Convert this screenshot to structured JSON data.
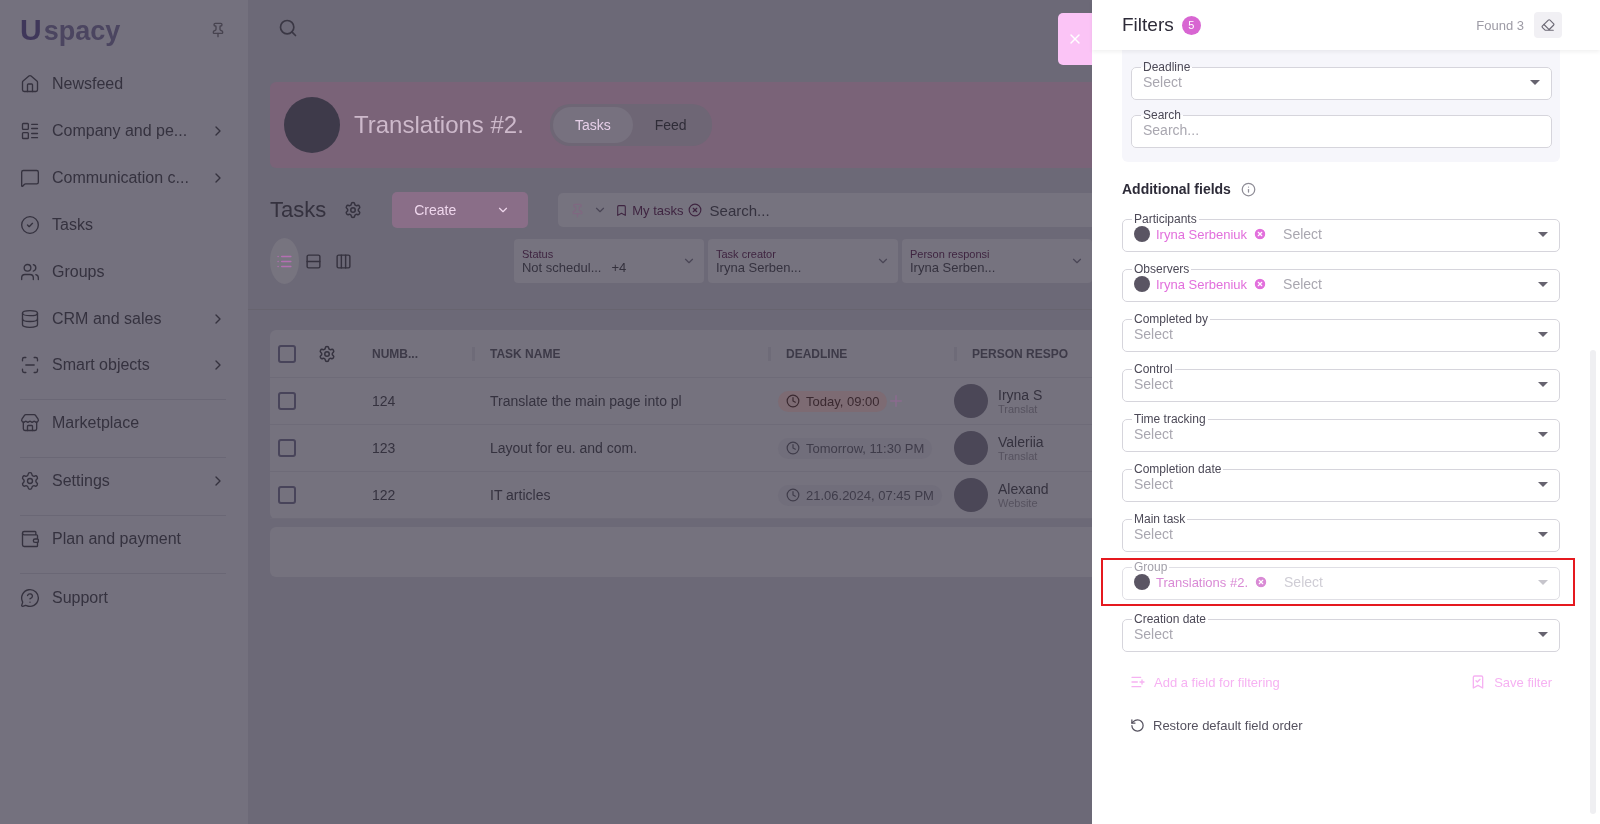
{
  "sidebar": {
    "logo": {
      "mark": "U",
      "text": "spacy"
    },
    "items": [
      {
        "label": "Newsfeed",
        "submenu": false,
        "divider_after": false
      },
      {
        "label": "Company and pe...",
        "submenu": true,
        "divider_after": false
      },
      {
        "label": "Communication c...",
        "submenu": true,
        "divider_after": false
      },
      {
        "label": "Tasks",
        "submenu": false,
        "divider_after": false
      },
      {
        "label": "Groups",
        "submenu": false,
        "divider_after": false
      },
      {
        "label": "CRM and sales",
        "submenu": true,
        "divider_after": false
      },
      {
        "label": "Smart objects",
        "submenu": true,
        "divider_after": true
      },
      {
        "label": "Marketplace",
        "submenu": false,
        "divider_after": true
      },
      {
        "label": "Settings",
        "submenu": true,
        "divider_after": true
      },
      {
        "label": "Plan and payment",
        "submenu": false,
        "divider_after": true
      },
      {
        "label": "Support",
        "submenu": false,
        "divider_after": false
      }
    ]
  },
  "group_banner": {
    "title": "Translations #2.",
    "tabs": [
      {
        "label": "Tasks",
        "selected": true
      },
      {
        "label": "Feed",
        "selected": false
      }
    ]
  },
  "toolbar": {
    "title": "Tasks",
    "create_button": "Create",
    "search_chip": "My tasks",
    "search_placeholder": "Search..."
  },
  "views": [
    {
      "selected": true
    },
    {
      "selected": false
    },
    {
      "selected": false
    }
  ],
  "quick_filters": [
    {
      "label": "Status",
      "value": "Not schedul...",
      "extra": "+4"
    },
    {
      "label": "Task creator",
      "value": "Iryna Serben..."
    },
    {
      "label": "Person responsi",
      "value": "Iryna Serben..."
    }
  ],
  "table": {
    "select_all_checked": false,
    "columns": [
      "NUMB...",
      "TASK NAME",
      "DEADLINE",
      "PERSON RESPO"
    ],
    "rows": [
      {
        "checked": false,
        "number": "124",
        "name": "Translate the main page into pl",
        "deadline": "Today, 09:00",
        "overdue": true,
        "person": "Iryna S",
        "role": "Translat"
      },
      {
        "checked": false,
        "number": "123",
        "name": "Layout for eu. and com.",
        "deadline": "Tomorrow, 11:30 PM",
        "overdue": false,
        "person": "Valeriia",
        "role": "Translat"
      },
      {
        "checked": false,
        "number": "122",
        "name": "IT articles",
        "deadline": "21.06.2024, 07:45 PM",
        "overdue": false,
        "person": "Alexand",
        "role": "Website"
      }
    ]
  },
  "drawer": {
    "title": "Filters",
    "count": "5",
    "found": "Found 3",
    "top_fields": [
      {
        "label": "Deadline",
        "kind": "select",
        "placeholder": "Select"
      },
      {
        "label": "Search",
        "kind": "text",
        "placeholder": "Search..."
      }
    ],
    "section_title": "Additional fields",
    "fields": [
      {
        "label": "Participants",
        "chip": "Iryna Serbeniuk",
        "placeholder": "Select",
        "disabled": false,
        "highlighted": false
      },
      {
        "label": "Observers",
        "chip": "Iryna Serbeniuk",
        "placeholder": "Select",
        "disabled": false,
        "highlighted": false
      },
      {
        "label": "Completed by",
        "placeholder": "Select",
        "disabled": false,
        "highlighted": false
      },
      {
        "label": "Control",
        "placeholder": "Select",
        "disabled": false,
        "highlighted": false
      },
      {
        "label": "Time tracking",
        "placeholder": "Select",
        "disabled": false,
        "highlighted": false
      },
      {
        "label": "Completion date",
        "placeholder": "Select",
        "disabled": false,
        "highlighted": false
      },
      {
        "label": "Main task",
        "placeholder": "Select",
        "disabled": false,
        "highlighted": false
      },
      {
        "label": "Group",
        "chip": "Translations #2.",
        "placeholder": "Select",
        "disabled": true,
        "highlighted": true
      },
      {
        "label": "Creation date",
        "placeholder": "Select",
        "disabled": false,
        "highlighted": false
      }
    ],
    "add_field": "Add a field for filtering",
    "save_filter": "Save filter",
    "restore": "Restore default field order"
  }
}
